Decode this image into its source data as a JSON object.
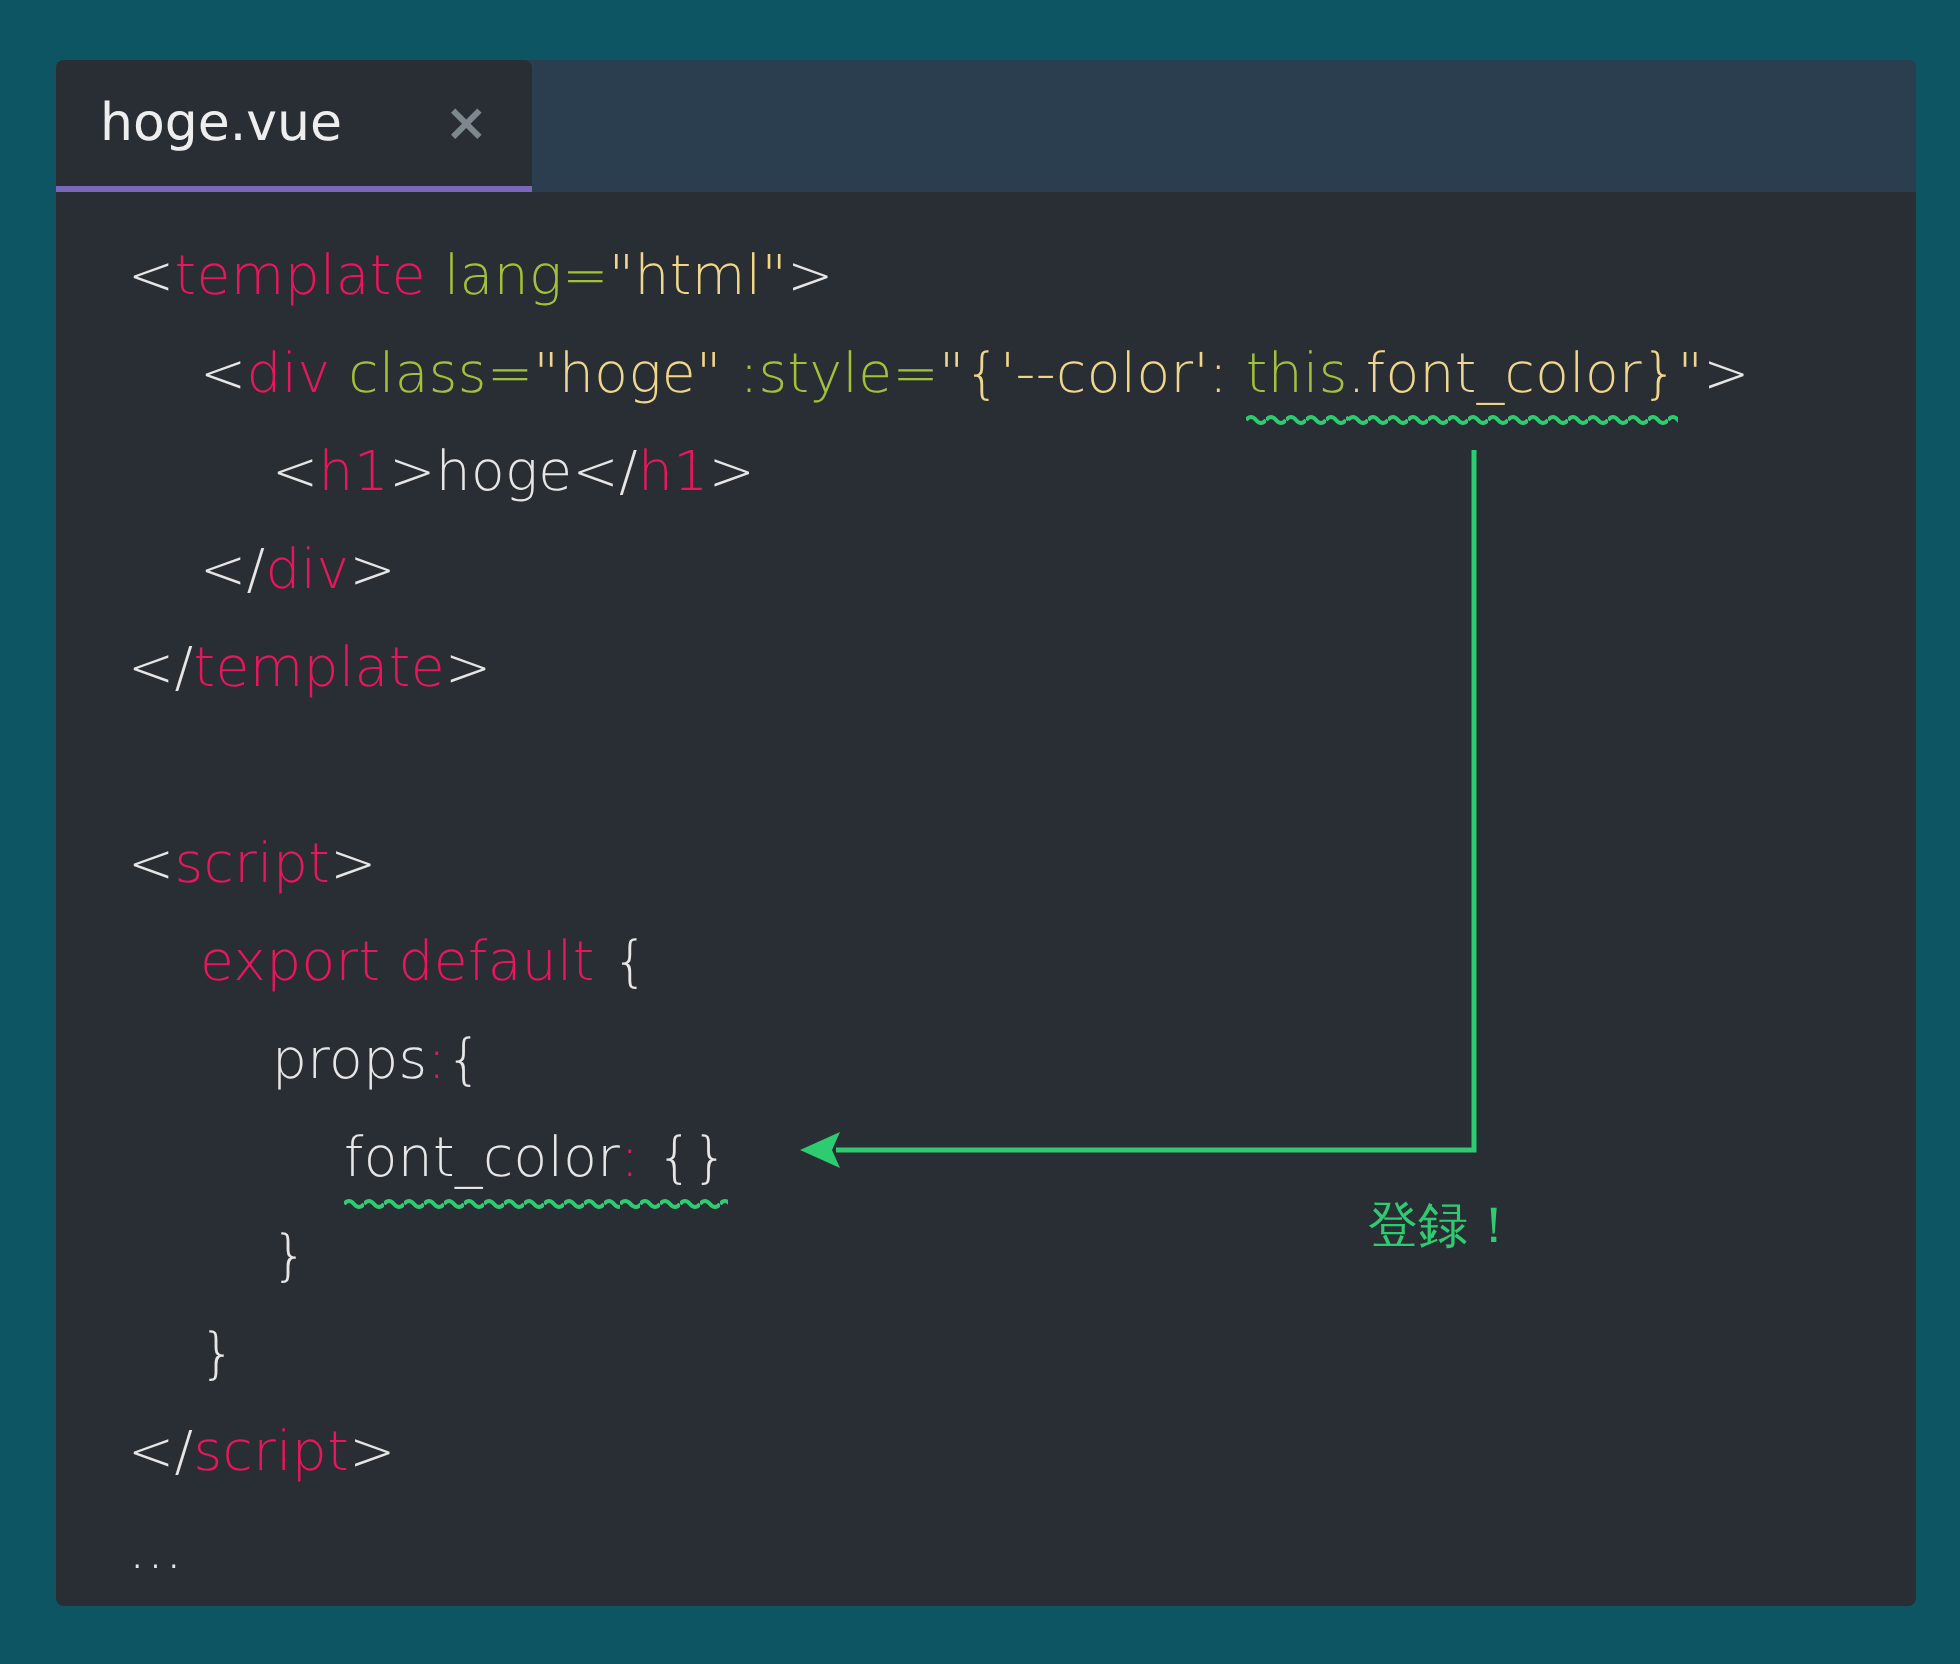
{
  "tabs": [
    {
      "label": "hoge.vue",
      "close": "×",
      "selected": true
    }
  ],
  "code_blocks": [
    {
      "lines": [
        {
          "tokens": [
            {
              "text": "<",
              "kind": "punct"
            },
            {
              "text": "template",
              "kind": "tag"
            },
            {
              "text": " lang=",
              "kind": "attr"
            },
            {
              "text": "\"html\"",
              "kind": "string"
            },
            {
              "text": ">",
              "kind": "punct"
            }
          ],
          "children": [
            {
              "tokens": [
                {
                  "text": "<",
                  "kind": "punct"
                },
                {
                  "text": "div",
                  "kind": "tag"
                },
                {
                  "text": " class=",
                  "kind": "attr"
                },
                {
                  "text": "\"hoge\"",
                  "kind": "string"
                },
                {
                  "text": " :style=",
                  "kind": "attr"
                },
                {
                  "text": "\"{'--color': ",
                  "kind": "string"
                },
                {
                  "text": "this",
                  "kind": "attr",
                  "squiggle": true
                },
                {
                  "text": ".font_color}",
                  "kind": "string",
                  "squiggle": true
                },
                {
                  "text": "\"",
                  "kind": "string"
                },
                {
                  "text": ">",
                  "kind": "punct"
                }
              ],
              "children": [
                {
                  "tokens": [
                    {
                      "text": "<",
                      "kind": "punct"
                    },
                    {
                      "text": "h1",
                      "kind": "tag"
                    },
                    {
                      "text": ">hoge</",
                      "kind": "punct"
                    },
                    {
                      "text": "h1",
                      "kind": "tag"
                    },
                    {
                      "text": ">",
                      "kind": "punct"
                    }
                  ]
                }
              ]
            },
            {
              "tokens": [
                {
                  "text": "</",
                  "kind": "punct"
                },
                {
                  "text": "div",
                  "kind": "tag"
                },
                {
                  "text": ">",
                  "kind": "punct"
                }
              ]
            }
          ]
        },
        {
          "tokens": [
            {
              "text": "</",
              "kind": "punct"
            },
            {
              "text": "template",
              "kind": "tag"
            },
            {
              "text": ">",
              "kind": "punct"
            }
          ]
        }
      ]
    },
    {
      "lines": [
        {
          "tokens": [
            {
              "text": "<",
              "kind": "punct"
            },
            {
              "text": "script",
              "kind": "tag"
            },
            {
              "text": ">",
              "kind": "punct"
            }
          ],
          "children": [
            {
              "tokens": [
                {
                  "text": "export default",
                  "kind": "tag"
                },
                {
                  "text": " {",
                  "kind": "punct"
                }
              ],
              "children": [
                {
                  "tokens": [
                    {
                      "text": "props",
                      "kind": "punct"
                    },
                    {
                      "text": ":",
                      "kind": "tag"
                    },
                    {
                      "text": "{",
                      "kind": "punct"
                    }
                  ],
                  "children": [
                    {
                      "tokens": [
                        {
                          "text": "font_color",
                          "kind": "punct",
                          "squiggle": true
                        },
                        {
                          "text": ":",
                          "kind": "tag",
                          "squiggle": true
                        },
                        {
                          "text": " {}",
                          "kind": "punct",
                          "squiggle": true
                        }
                      ]
                    }
                  ]
                },
                {
                  "tokens": [
                    {
                      "text": "}",
                      "kind": "punct"
                    }
                  ]
                }
              ]
            },
            {
              "tokens": [
                {
                  "text": "}",
                  "kind": "punct"
                }
              ]
            }
          ]
        },
        {
          "tokens": [
            {
              "text": "</",
              "kind": "punct"
            },
            {
              "text": "script",
              "kind": "tag"
            },
            {
              "text": ">",
              "kind": "punct"
            }
          ]
        },
        {
          "tokens": [
            {
              "text": "…",
              "kind": "punct"
            }
          ]
        }
      ]
    }
  ],
  "annotation": {
    "label": "登録！"
  }
}
